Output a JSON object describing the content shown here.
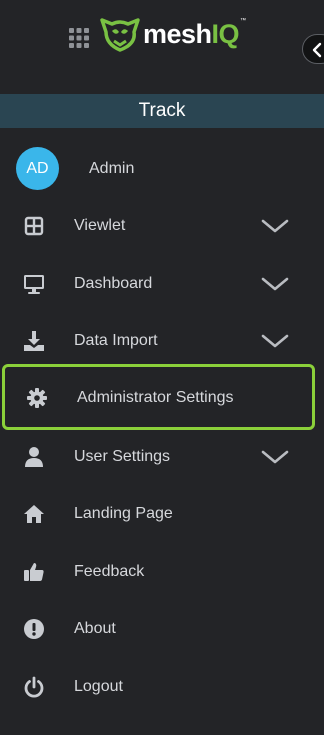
{
  "brand": {
    "logo_word": "mesh",
    "logo_accent": "IQ",
    "trademark": "™",
    "accent_color": "#79c143"
  },
  "title_bar": {
    "label": "Track",
    "background": "#2a4552"
  },
  "user": {
    "initials": "AD",
    "name": "Admin",
    "avatar_color": "#3ab6ea"
  },
  "menu": {
    "items": [
      {
        "label": "Viewlet",
        "icon": "grid-icon",
        "expandable": true
      },
      {
        "label": "Dashboard",
        "icon": "monitor-icon",
        "expandable": true
      },
      {
        "label": "Data Import",
        "icon": "download-icon",
        "expandable": true
      },
      {
        "label": "Administrator Settings",
        "icon": "gear-icon",
        "expandable": false,
        "highlighted": true
      },
      {
        "label": "User Settings",
        "icon": "user-icon",
        "expandable": true
      },
      {
        "label": "Landing Page",
        "icon": "home-icon",
        "expandable": false
      },
      {
        "label": "Feedback",
        "icon": "thumbs-up-icon",
        "expandable": false
      },
      {
        "label": "About",
        "icon": "info-icon",
        "expandable": false
      },
      {
        "label": "Logout",
        "icon": "power-icon",
        "expandable": false
      }
    ]
  },
  "highlight_color": "#8bd03a"
}
